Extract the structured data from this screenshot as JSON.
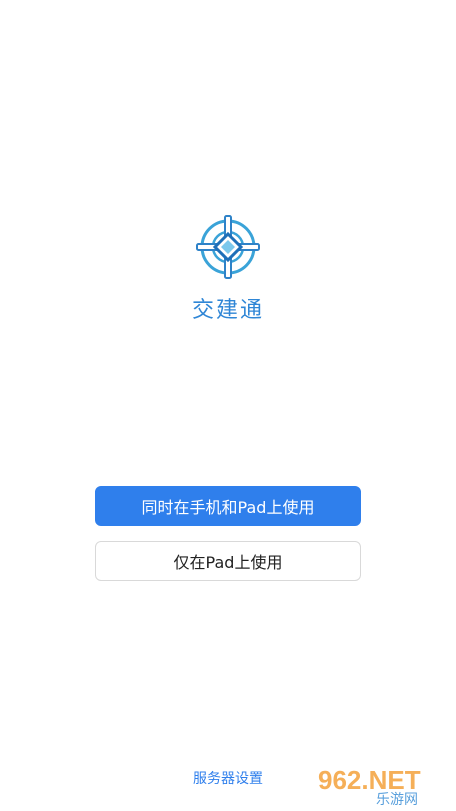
{
  "app": {
    "name": "交建通",
    "logo_icon": "crosshair-logo-icon",
    "brand_color": "#2f86d6"
  },
  "actions": {
    "primary_label": "同时在手机和Pad上使用",
    "secondary_label": "仅在Pad上使用",
    "primary_color": "#2f7fec"
  },
  "footer": {
    "server_settings_label": "服务器设置"
  },
  "watermark": {
    "text_top": "962.NET",
    "text_bottom": "乐游网"
  }
}
